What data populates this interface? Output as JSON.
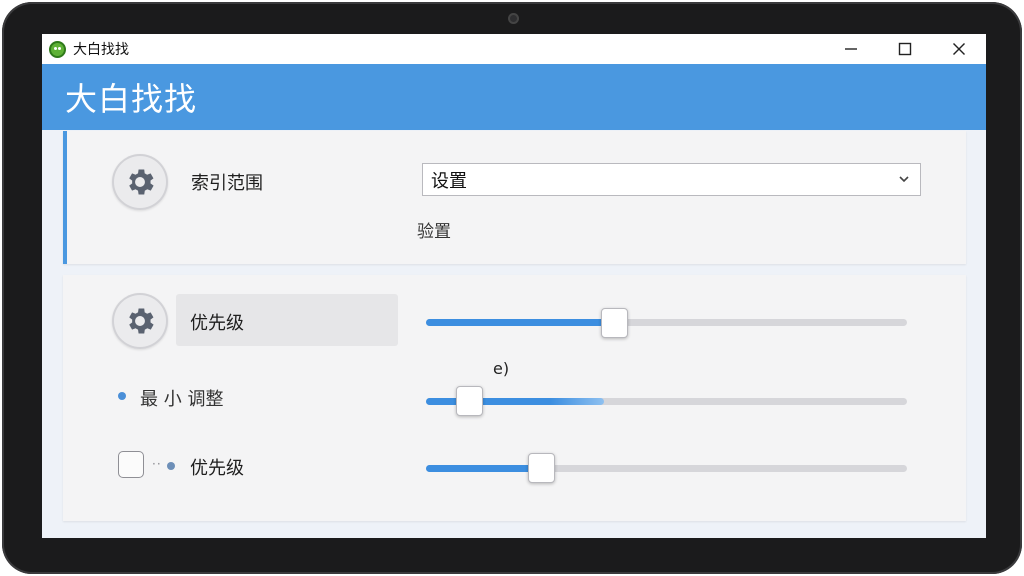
{
  "window": {
    "title": "大白找找",
    "controls": {
      "minimize": "—",
      "maximize": "☐",
      "close": "✕"
    }
  },
  "header": {
    "title": "大白找找"
  },
  "index_scope": {
    "label": "索引范围",
    "select_value": "设置",
    "hint": "验置",
    "icon": "gear-icon"
  },
  "priority": {
    "label": "优先级",
    "icon": "gear-icon",
    "slider_value": 0.39,
    "marker_text": "e)"
  },
  "minimum_adjust": {
    "label": "最 小 调整",
    "slider_value": 0.09,
    "fill_value": 0.37
  },
  "priority_check": {
    "label": "优先级",
    "checked": false,
    "slider_value": 0.24
  },
  "colors": {
    "accent": "#4a98e0",
    "slider_fill": "#3c8ee0",
    "panel": "#f4f4f5"
  }
}
